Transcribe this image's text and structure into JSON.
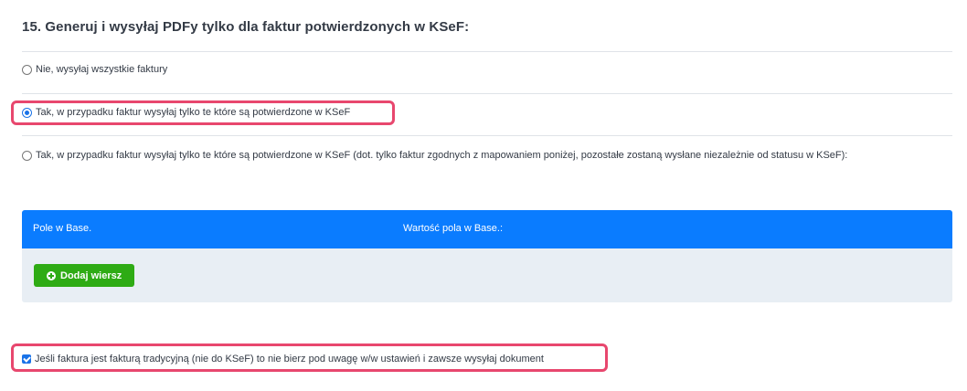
{
  "section": {
    "title": "15. Generuj i wysyłaj PDFy tylko dla faktur potwierdzonych w KSeF:"
  },
  "options": [
    {
      "label": "Nie, wysyłaj wszystkie faktury",
      "selected": false
    },
    {
      "label": "Tak, w przypadku faktur wysyłaj tylko te które są potwierdzone w KSeF",
      "selected": true
    },
    {
      "label": "Tak, w przypadku faktur wysyłaj tylko te które są potwierdzone w KSeF (dot. tylko faktur zgodnych z mapowaniem poniżej, pozostałe zostaną wysłane niezależnie od statusu w KSeF):",
      "selected": false
    }
  ],
  "mapping": {
    "col_field": "Pole w Base.",
    "col_value": "Wartość pola w Base.:",
    "add_row_label": "Dodaj wiersz"
  },
  "traditional_invoice": {
    "label": "Jeśli faktura jest fakturą tradycyjną (nie do KSeF) to nie bierz pod uwagę w/w ustawień i zawsze wysyłaj dokument",
    "checked": true
  },
  "colors": {
    "accent_blue": "#0a7cff",
    "add_button_green": "#2eab14",
    "highlight_pink": "#e8476e"
  }
}
